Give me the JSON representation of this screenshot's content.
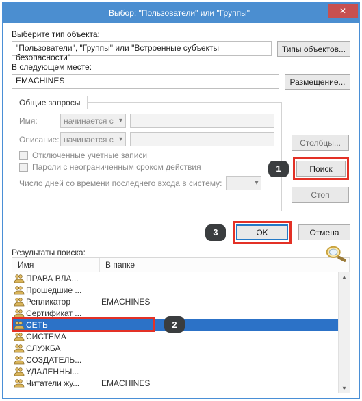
{
  "window": {
    "title": "Выбор: \"Пользователи\" или \"Группы\"",
    "close_glyph": "✕"
  },
  "section_object_type": {
    "label": "Выберите тип объекта:",
    "value": "\"Пользователи\", \"Группы\" или \"Встроенные субъекты безопасности\"",
    "button": "Типы объектов..."
  },
  "section_location": {
    "label": "В следующем месте:",
    "value": "EMACHINES",
    "button": "Размещение..."
  },
  "queries": {
    "tab": "Общие запросы",
    "name_label": "Имя:",
    "name_mode": "начинается с",
    "desc_label": "Описание:",
    "desc_mode": "начинается с",
    "chk_disabled": "Отключенные учетные записи",
    "chk_pwd": "Пароли с неограниченным сроком действия",
    "days_label": "Число дней со времени последнего входа в систему:"
  },
  "side_buttons": {
    "columns": "Столбцы...",
    "search": "Поиск",
    "stop": "Стоп"
  },
  "annotations": {
    "one": "1",
    "two": "2",
    "three": "3"
  },
  "footer": {
    "ok": "OK",
    "cancel": "Отмена"
  },
  "results": {
    "label": "Результаты поиска:",
    "col_name": "Имя",
    "col_folder": "В папке",
    "items": [
      {
        "name": "ПРАВА ВЛА...",
        "folder": ""
      },
      {
        "name": "Прошедшие ...",
        "folder": ""
      },
      {
        "name": "Репликатор",
        "folder": "EMACHINES"
      },
      {
        "name": "Сертификат ...",
        "folder": ""
      },
      {
        "name": "СЕТЬ",
        "folder": "",
        "selected": true
      },
      {
        "name": "СИСТЕМА",
        "folder": ""
      },
      {
        "name": "СЛУЖБА",
        "folder": ""
      },
      {
        "name": "СОЗДАТЕЛЬ...",
        "folder": ""
      },
      {
        "name": "УДАЛЕННЫ...",
        "folder": ""
      },
      {
        "name": "Читатели жу...",
        "folder": "EMACHINES"
      }
    ]
  }
}
